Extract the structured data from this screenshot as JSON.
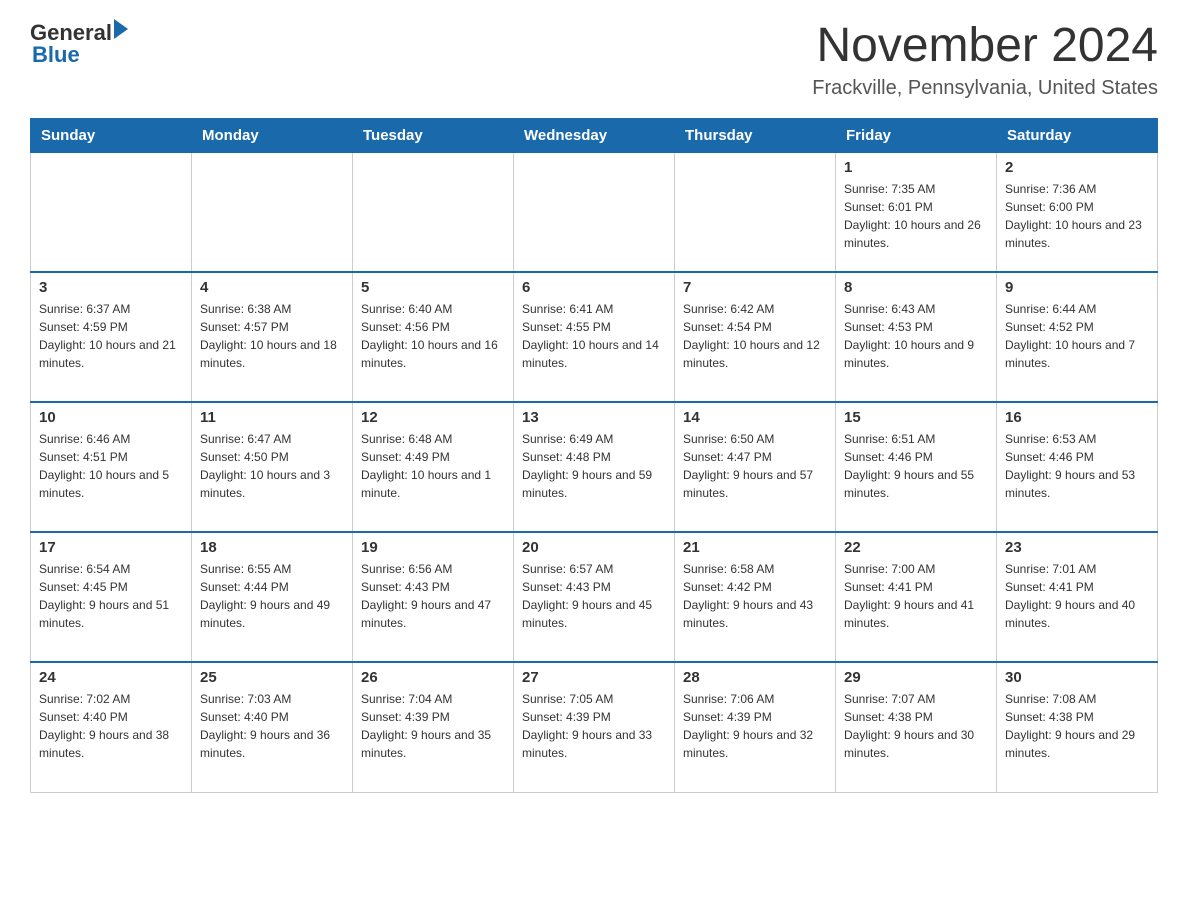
{
  "header": {
    "logo_general": "General",
    "logo_blue": "Blue",
    "title": "November 2024",
    "subtitle": "Frackville, Pennsylvania, United States"
  },
  "weekdays": [
    "Sunday",
    "Monday",
    "Tuesday",
    "Wednesday",
    "Thursday",
    "Friday",
    "Saturday"
  ],
  "weeks": [
    [
      {
        "day": "",
        "sunrise": "",
        "sunset": "",
        "daylight": ""
      },
      {
        "day": "",
        "sunrise": "",
        "sunset": "",
        "daylight": ""
      },
      {
        "day": "",
        "sunrise": "",
        "sunset": "",
        "daylight": ""
      },
      {
        "day": "",
        "sunrise": "",
        "sunset": "",
        "daylight": ""
      },
      {
        "day": "",
        "sunrise": "",
        "sunset": "",
        "daylight": ""
      },
      {
        "day": "1",
        "sunrise": "Sunrise: 7:35 AM",
        "sunset": "Sunset: 6:01 PM",
        "daylight": "Daylight: 10 hours and 26 minutes."
      },
      {
        "day": "2",
        "sunrise": "Sunrise: 7:36 AM",
        "sunset": "Sunset: 6:00 PM",
        "daylight": "Daylight: 10 hours and 23 minutes."
      }
    ],
    [
      {
        "day": "3",
        "sunrise": "Sunrise: 6:37 AM",
        "sunset": "Sunset: 4:59 PM",
        "daylight": "Daylight: 10 hours and 21 minutes."
      },
      {
        "day": "4",
        "sunrise": "Sunrise: 6:38 AM",
        "sunset": "Sunset: 4:57 PM",
        "daylight": "Daylight: 10 hours and 18 minutes."
      },
      {
        "day": "5",
        "sunrise": "Sunrise: 6:40 AM",
        "sunset": "Sunset: 4:56 PM",
        "daylight": "Daylight: 10 hours and 16 minutes."
      },
      {
        "day": "6",
        "sunrise": "Sunrise: 6:41 AM",
        "sunset": "Sunset: 4:55 PM",
        "daylight": "Daylight: 10 hours and 14 minutes."
      },
      {
        "day": "7",
        "sunrise": "Sunrise: 6:42 AM",
        "sunset": "Sunset: 4:54 PM",
        "daylight": "Daylight: 10 hours and 12 minutes."
      },
      {
        "day": "8",
        "sunrise": "Sunrise: 6:43 AM",
        "sunset": "Sunset: 4:53 PM",
        "daylight": "Daylight: 10 hours and 9 minutes."
      },
      {
        "day": "9",
        "sunrise": "Sunrise: 6:44 AM",
        "sunset": "Sunset: 4:52 PM",
        "daylight": "Daylight: 10 hours and 7 minutes."
      }
    ],
    [
      {
        "day": "10",
        "sunrise": "Sunrise: 6:46 AM",
        "sunset": "Sunset: 4:51 PM",
        "daylight": "Daylight: 10 hours and 5 minutes."
      },
      {
        "day": "11",
        "sunrise": "Sunrise: 6:47 AM",
        "sunset": "Sunset: 4:50 PM",
        "daylight": "Daylight: 10 hours and 3 minutes."
      },
      {
        "day": "12",
        "sunrise": "Sunrise: 6:48 AM",
        "sunset": "Sunset: 4:49 PM",
        "daylight": "Daylight: 10 hours and 1 minute."
      },
      {
        "day": "13",
        "sunrise": "Sunrise: 6:49 AM",
        "sunset": "Sunset: 4:48 PM",
        "daylight": "Daylight: 9 hours and 59 minutes."
      },
      {
        "day": "14",
        "sunrise": "Sunrise: 6:50 AM",
        "sunset": "Sunset: 4:47 PM",
        "daylight": "Daylight: 9 hours and 57 minutes."
      },
      {
        "day": "15",
        "sunrise": "Sunrise: 6:51 AM",
        "sunset": "Sunset: 4:46 PM",
        "daylight": "Daylight: 9 hours and 55 minutes."
      },
      {
        "day": "16",
        "sunrise": "Sunrise: 6:53 AM",
        "sunset": "Sunset: 4:46 PM",
        "daylight": "Daylight: 9 hours and 53 minutes."
      }
    ],
    [
      {
        "day": "17",
        "sunrise": "Sunrise: 6:54 AM",
        "sunset": "Sunset: 4:45 PM",
        "daylight": "Daylight: 9 hours and 51 minutes."
      },
      {
        "day": "18",
        "sunrise": "Sunrise: 6:55 AM",
        "sunset": "Sunset: 4:44 PM",
        "daylight": "Daylight: 9 hours and 49 minutes."
      },
      {
        "day": "19",
        "sunrise": "Sunrise: 6:56 AM",
        "sunset": "Sunset: 4:43 PM",
        "daylight": "Daylight: 9 hours and 47 minutes."
      },
      {
        "day": "20",
        "sunrise": "Sunrise: 6:57 AM",
        "sunset": "Sunset: 4:43 PM",
        "daylight": "Daylight: 9 hours and 45 minutes."
      },
      {
        "day": "21",
        "sunrise": "Sunrise: 6:58 AM",
        "sunset": "Sunset: 4:42 PM",
        "daylight": "Daylight: 9 hours and 43 minutes."
      },
      {
        "day": "22",
        "sunrise": "Sunrise: 7:00 AM",
        "sunset": "Sunset: 4:41 PM",
        "daylight": "Daylight: 9 hours and 41 minutes."
      },
      {
        "day": "23",
        "sunrise": "Sunrise: 7:01 AM",
        "sunset": "Sunset: 4:41 PM",
        "daylight": "Daylight: 9 hours and 40 minutes."
      }
    ],
    [
      {
        "day": "24",
        "sunrise": "Sunrise: 7:02 AM",
        "sunset": "Sunset: 4:40 PM",
        "daylight": "Daylight: 9 hours and 38 minutes."
      },
      {
        "day": "25",
        "sunrise": "Sunrise: 7:03 AM",
        "sunset": "Sunset: 4:40 PM",
        "daylight": "Daylight: 9 hours and 36 minutes."
      },
      {
        "day": "26",
        "sunrise": "Sunrise: 7:04 AM",
        "sunset": "Sunset: 4:39 PM",
        "daylight": "Daylight: 9 hours and 35 minutes."
      },
      {
        "day": "27",
        "sunrise": "Sunrise: 7:05 AM",
        "sunset": "Sunset: 4:39 PM",
        "daylight": "Daylight: 9 hours and 33 minutes."
      },
      {
        "day": "28",
        "sunrise": "Sunrise: 7:06 AM",
        "sunset": "Sunset: 4:39 PM",
        "daylight": "Daylight: 9 hours and 32 minutes."
      },
      {
        "day": "29",
        "sunrise": "Sunrise: 7:07 AM",
        "sunset": "Sunset: 4:38 PM",
        "daylight": "Daylight: 9 hours and 30 minutes."
      },
      {
        "day": "30",
        "sunrise": "Sunrise: 7:08 AM",
        "sunset": "Sunset: 4:38 PM",
        "daylight": "Daylight: 9 hours and 29 minutes."
      }
    ]
  ]
}
